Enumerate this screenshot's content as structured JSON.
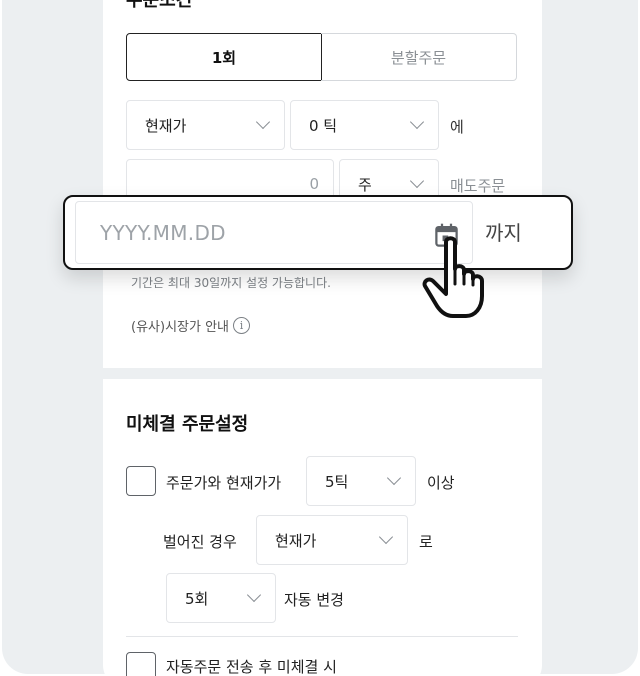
{
  "condition": {
    "title": "주문조건",
    "tab_once": "1회",
    "tab_split": "분할주문",
    "price_type": "현재가",
    "tick_offset": "0 틱",
    "tick_suffix": "에",
    "qty_value": "0",
    "qty_unit": "주",
    "order_label": "매도주문"
  },
  "date_popup": {
    "placeholder": "YYYY.MM.DD",
    "until_label": "까지",
    "calendar_icon": "calendar-icon"
  },
  "hint_text": "기간은 최대 30일까지 설정 가능합니다.",
  "market_guide": {
    "label": "(유사)시장가 안내",
    "icon_glyph": "i"
  },
  "unfilled": {
    "title": "미체결 주문설정",
    "row1_text": "주문가와 현재가가",
    "tick_select": "5틱",
    "row1_suffix": "이상",
    "row2_prefix": "벌어진 경우",
    "price_select": "현재가",
    "row2_suffix": "로",
    "count_select": "5회",
    "row3_suffix": "자동 변경",
    "row4_text": "자동주문 전송 후 미체결 시"
  },
  "colors": {
    "background": "#eceff1",
    "card": "#ffffff",
    "accent_border": "#111111",
    "muted_text": "#8a8f94"
  }
}
